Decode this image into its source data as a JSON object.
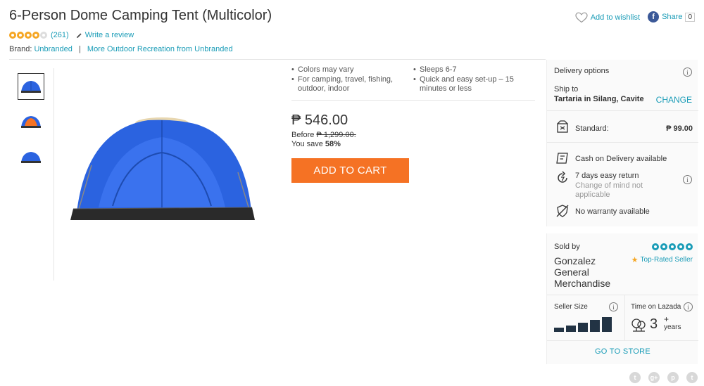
{
  "product": {
    "title": "6-Person Dome Camping Tent (Multicolor)",
    "rating_stars": 4,
    "review_count": "(261)",
    "write_review": "Write a review",
    "brand_label": "Brand:",
    "brand": "Unbranded",
    "brand_separator": "|",
    "more_from": "More Outdoor Recreation from Unbranded"
  },
  "actions": {
    "wishlist": "Add to wishlist",
    "share": "Share",
    "share_count": "0"
  },
  "features": {
    "left": [
      "Colors may vary",
      "For camping, travel, fishing, outdoor, indoor"
    ],
    "right": [
      "Sleeps 6-7",
      "Quick and easy set-up – 15 minutes or less"
    ]
  },
  "pricing": {
    "price": "₱ 546.00",
    "before_label": "Before",
    "before_price": "₱ 1,299.00",
    "before_suffix": ".",
    "save_label": "You save",
    "save_percent": "58%",
    "add_to_cart": "ADD TO CART"
  },
  "delivery": {
    "title": "Delivery options",
    "ship_to_label": "Ship to",
    "ship_to_location": "Tartaria in Silang, Cavite",
    "change": "CHANGE",
    "standard_label": "Standard:",
    "standard_price": "₱ 99.00",
    "cod": "Cash on Delivery available",
    "return_title": "7 days easy return",
    "return_sub": "Change of mind not applicable",
    "warranty": "No warranty available",
    "info_glyph": "i"
  },
  "seller": {
    "sold_by_label": "Sold by",
    "name": "Gonzalez General Merchandise",
    "stars": 5,
    "badge": "Top-Rated Seller",
    "size_label": "Seller Size",
    "size_level": 5,
    "time_label": "Time on Lazada",
    "years": "3",
    "years_plus": "+",
    "years_word": "years",
    "go_to_store": "GO TO STORE"
  },
  "colors": {
    "accent": "#1a9cb7",
    "cart_orange": "#f57224",
    "star_gold": "#f5a623",
    "tent_blue": "#2b63e0"
  },
  "icons": {
    "social": [
      "twitter-icon",
      "google-plus-icon",
      "pinterest-icon",
      "tumblr-icon"
    ],
    "social_glyphs": [
      "t",
      "g+",
      "p",
      "t"
    ]
  }
}
